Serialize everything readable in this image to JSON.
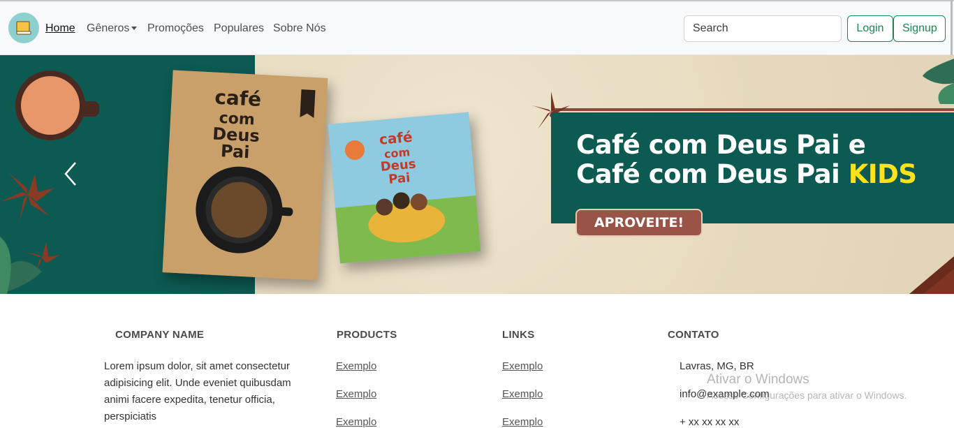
{
  "nav": {
    "home": "Home",
    "generos": "Gêneros",
    "promocoes": "Promoções",
    "populares": "Populares",
    "sobre": "Sobre Nós",
    "search_placeholder": "Search",
    "login": "Login",
    "signup": "Signup"
  },
  "banner": {
    "title_line1": "Café com Deus Pai e",
    "title_line2": "Café com Deus Pai ",
    "title_kids": "KIDS",
    "cta": "APROVEITE!"
  },
  "footer": {
    "company_title": "COMPANY NAME",
    "company_text": "Lorem ipsum dolor, sit amet consectetur adipisicing elit. Unde eveniet quibusdam animi facere expedita, tenetur officia, perspiciatis",
    "products_title": "PRODUCTS",
    "products": [
      "Exemplo",
      "Exemplo",
      "Exemplo"
    ],
    "links_title": "LINKS",
    "links": [
      "Exemplo",
      "Exemplo",
      "Exemplo"
    ],
    "contact_title": "CONTATO",
    "contact": [
      "Lavras, MG, BR",
      "info@example.com",
      "+ xx xx xx xx"
    ]
  },
  "watermark": {
    "line1": "Ativar o Windows",
    "line2": "Acesse Configurações para ativar o Windows."
  },
  "colors": {
    "accent": "#198754",
    "banner_green": "#0d5a52",
    "kids_yellow": "#ffe31a",
    "cta": "#9a5447"
  }
}
